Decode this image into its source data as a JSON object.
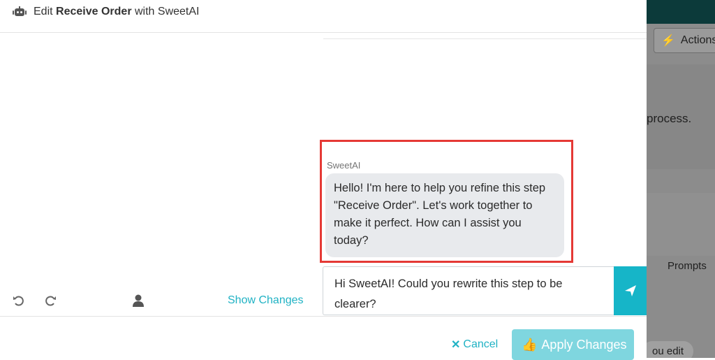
{
  "header": {
    "prefix": "Edit",
    "step_name": "Receive Order",
    "suffix": "with SweetAI"
  },
  "chat": {
    "sender": "SweetAI",
    "message": "Hello! I'm here to help you refine this step \"Receive Order\". Let's work together to make it perfect. How can I assist you today?"
  },
  "input": {
    "value": "Hi SweetAI! Could you rewrite this step to be clearer?"
  },
  "toolbar": {
    "show_changes_label": "Show Changes"
  },
  "footer": {
    "cancel_label": "Cancel",
    "apply_label": "Apply Changes"
  },
  "background": {
    "actions_label": "Actions",
    "partial_text": "process.",
    "prompts_label": "Prompts",
    "chip_label": "ou edit"
  },
  "icons": {
    "header": "robot-icon",
    "send": "send-icon",
    "undo": "undo-icon",
    "redo": "redo-icon",
    "user": "user-icon",
    "cancel": "close-icon",
    "apply": "thumbs-up-icon",
    "actions": "bolt-icon"
  },
  "colors": {
    "accent": "#16b5c8",
    "highlight_border": "#e53935",
    "apply_button": "#7fd6df"
  }
}
